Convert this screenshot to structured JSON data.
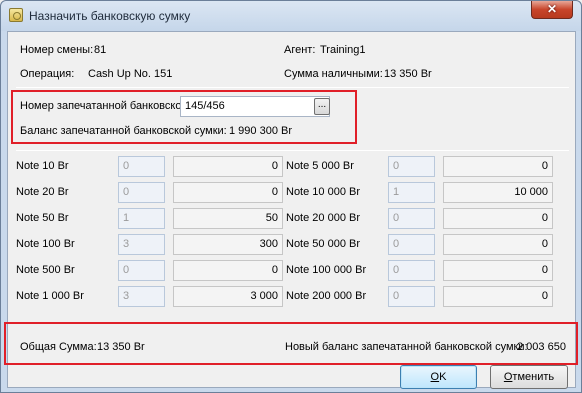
{
  "window": {
    "title": "Назначить банковскую сумку",
    "close_glyph": "✕"
  },
  "info": {
    "shift_label": "Номер смены:",
    "shift_value": "81",
    "agent_label": "Агент:",
    "agent_value": "Training1",
    "operation_label": "Операция:",
    "operation_value": "Cash Up No. 151",
    "cash_label": "Сумма наличными:",
    "cash_value": "13 350 Br"
  },
  "bag": {
    "number_label": "Номер запечатанной банковско",
    "number_value": "145/456",
    "browse_label": "...",
    "balance_label": "Баланс запечатанной банковской сумки:",
    "balance_value": "1 990 300 Br"
  },
  "notes_left": [
    {
      "label": "Note 10 Br",
      "count": "0",
      "amount": "0"
    },
    {
      "label": "Note 20 Br",
      "count": "0",
      "amount": "0"
    },
    {
      "label": "Note 50 Br",
      "count": "1",
      "amount": "50"
    },
    {
      "label": "Note 100 Br",
      "count": "3",
      "amount": "300"
    },
    {
      "label": "Note 500 Br",
      "count": "0",
      "amount": "0"
    },
    {
      "label": "Note 1 000 Br",
      "count": "3",
      "amount": "3 000"
    }
  ],
  "notes_right": [
    {
      "label": "Note 5 000 Br",
      "count": "0",
      "amount": "0"
    },
    {
      "label": "Note 10 000 Br",
      "count": "1",
      "amount": "10 000"
    },
    {
      "label": "Note 20 000 Br",
      "count": "0",
      "amount": "0"
    },
    {
      "label": "Note 50 000 Br",
      "count": "0",
      "amount": "0"
    },
    {
      "label": "Note 100 000 Br",
      "count": "0",
      "amount": "0"
    },
    {
      "label": "Note 200 000 Br",
      "count": "0",
      "amount": "0"
    }
  ],
  "totals": {
    "total_label": "Общая Сумма:",
    "total_value": "13 350 Br",
    "new_balance_label": "Новый баланс запечатанной банковской сумки:",
    "new_balance_value": "2 003 650"
  },
  "buttons": {
    "ok_mnemonic": "O",
    "ok_rest": "K",
    "cancel_mnemonic": "О",
    "cancel_rest": "тменить"
  },
  "colors": {
    "highlight": "#e01f28"
  }
}
